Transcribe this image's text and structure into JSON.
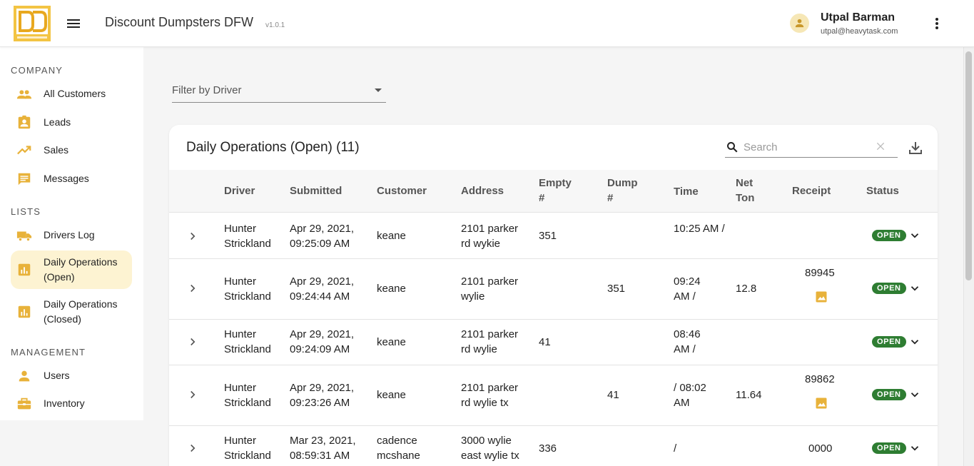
{
  "header": {
    "logo_icon": "discount-dumpsters-logo",
    "title": "Discount Dumpsters DFW",
    "version": "v1.0.1",
    "user_name": "Utpal Barman",
    "user_email": "utpal@heavytask.com"
  },
  "sidebar": {
    "company_label": "COMPANY",
    "lists_label": "LISTS",
    "management_label": "MANAGEMENT",
    "items": [
      {
        "label": "All Customers",
        "icon": "people-icon"
      },
      {
        "label": "Leads",
        "icon": "contact-badge-icon"
      },
      {
        "label": "Sales",
        "icon": "trending-up-icon"
      },
      {
        "label": "Messages",
        "icon": "message-icon"
      },
      {
        "label": "Drivers Log",
        "icon": "truck-icon"
      },
      {
        "label": "Daily Operations (Open)",
        "icon": "bar-chart-icon"
      },
      {
        "label": "Daily Operations (Closed)",
        "icon": "bar-chart-icon"
      },
      {
        "label": "Users",
        "icon": "person-icon"
      },
      {
        "label": "Inventory",
        "icon": "briefcase-icon"
      }
    ]
  },
  "filter": {
    "label": "Filter by Driver"
  },
  "table": {
    "title": "Daily Operations (Open) (11)",
    "search_placeholder": "Search",
    "columns": [
      "Driver",
      "Submitted",
      "Customer",
      "Address",
      "Empty #",
      "Dump #",
      "Time",
      "Net Ton",
      "Receipt",
      "Status"
    ],
    "rows": [
      {
        "driver": "Hunter Strickland",
        "submitted": "Apr 29, 2021, 09:25:09 AM",
        "customer": "keane",
        "address": "2101 parker rd wykie",
        "empty": "351",
        "dump": "",
        "time": "10:25 AM /",
        "net_ton": "",
        "receipt": "",
        "status": "OPEN"
      },
      {
        "driver": "Hunter Strickland",
        "submitted": "Apr 29, 2021, 09:24:44 AM",
        "customer": "keane",
        "address": "2101 parker wylie",
        "empty": "",
        "dump": "351",
        "time": "09:24 AM /",
        "net_ton": "12.8",
        "receipt": "89945",
        "status": "OPEN"
      },
      {
        "driver": "Hunter Strickland",
        "submitted": "Apr 29, 2021, 09:24:09 AM",
        "customer": "keane",
        "address": "2101 parker rd wylie",
        "empty": "41",
        "dump": "",
        "time": "08:46 AM /",
        "net_ton": "",
        "receipt": "",
        "status": "OPEN"
      },
      {
        "driver": "Hunter Strickland",
        "submitted": "Apr 29, 2021, 09:23:26 AM",
        "customer": "keane",
        "address": "2101 parker rd wylie tx",
        "empty": "",
        "dump": "41",
        "time": "/ 08:02 AM",
        "net_ton": "11.64",
        "receipt": "89862",
        "status": "OPEN"
      },
      {
        "driver": "Hunter Strickland",
        "submitted": "Mar 23, 2021, 08:59:31 AM",
        "customer": "cadence mcshane",
        "address": "3000 wylie east wylie tx",
        "empty": "336",
        "dump": "",
        "time": "/",
        "net_ton": "",
        "receipt": "0000",
        "status": "OPEN"
      }
    ]
  },
  "colors": {
    "accent": "#e8b23a",
    "status_open": "#2e7d32",
    "active_nav_bg": "#fdf3d2"
  }
}
